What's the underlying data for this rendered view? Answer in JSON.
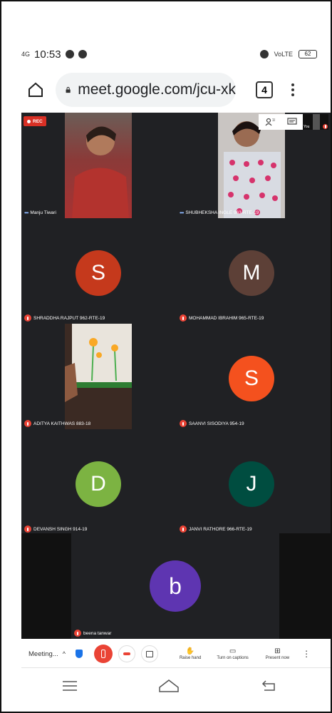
{
  "status_bar": {
    "signal": "4G",
    "time": "10:53",
    "lte": "VoLTE",
    "battery": "62"
  },
  "browser": {
    "url": "meet.google.com/jcu-xk",
    "tab_count": "4"
  },
  "meet": {
    "rec_label": "REC",
    "self_label": "You",
    "participants": [
      {
        "name": "Manju Tiwari",
        "initial": "",
        "color": ""
      },
      {
        "name": "SHUBHEKSHA INGLE 963-RTE-19",
        "initial": "",
        "color": ""
      },
      {
        "name": "SHRADDHA RAJPUT 962-RTE-19",
        "initial": "S",
        "color": "#c5391c"
      },
      {
        "name": "MOHAMMAD IBRAHIM 965-RTE-19",
        "initial": "M",
        "color": "#5d4037"
      },
      {
        "name": "ADITYA KAITHWAS 883-18",
        "initial": "",
        "color": ""
      },
      {
        "name": "SAANVI SISODIYA 954-19",
        "initial": "S",
        "color": "#f4511e"
      },
      {
        "name": "DEVANSH SINGH 914-19",
        "initial": "D",
        "color": "#7cb342"
      },
      {
        "name": "JANVI RATHORE 966-RTE-19",
        "initial": "J",
        "color": "#004d40"
      },
      {
        "name": "beena tanwar",
        "initial": "b",
        "color": "#5e35b1"
      }
    ]
  },
  "controls": {
    "meeting_label": "Meeting...",
    "raise_hand": "Raise hand",
    "captions": "Turn on captions",
    "present": "Present now"
  }
}
